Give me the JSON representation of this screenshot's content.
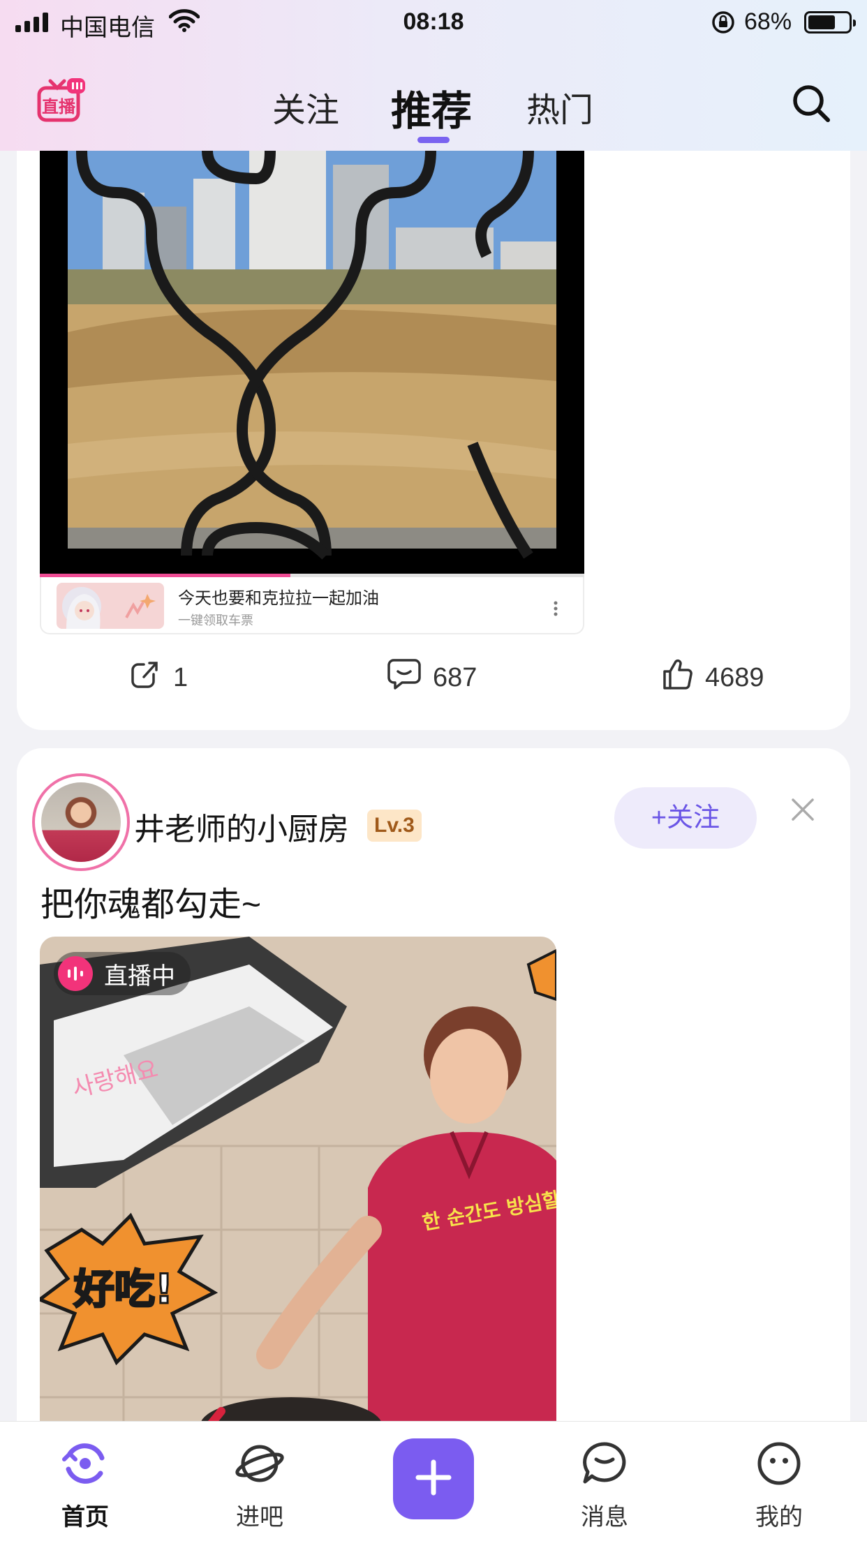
{
  "status_bar": {
    "carrier": "中国电信",
    "time": "08:18",
    "battery": "68%",
    "battery_level": 0.68
  },
  "top_nav": {
    "logo_text": "直播",
    "tabs": [
      {
        "label": "关注",
        "active": false
      },
      {
        "label": "推荐",
        "active": true
      },
      {
        "label": "热门",
        "active": false
      }
    ],
    "search_icon": "search-icon"
  },
  "post1": {
    "video_progress": 0.46,
    "promo": {
      "title": "今天也要和克拉拉一起加油",
      "subtitle": "一键领取车票"
    },
    "actions": {
      "share_count": "1",
      "comment_count": "687",
      "like_count": "4689"
    }
  },
  "post2": {
    "username": "井老师的小厨房",
    "level": "Lv.3",
    "follow_label": "+关注",
    "caption": "把你魂都勾走~",
    "live_badge": "直播中",
    "stickers": {
      "tasty": "好吃!",
      "korean_heart": "사랑해요",
      "korean_caption": "한 순간도 방심할 수 없다 ..."
    }
  },
  "tab_bar": {
    "items": [
      {
        "label": "首页",
        "icon": "home-icon",
        "active": true
      },
      {
        "label": "进吧",
        "icon": "planet-icon",
        "active": false
      },
      {
        "label": "",
        "icon": "plus-icon",
        "active": false
      },
      {
        "label": "消息",
        "icon": "message-icon",
        "active": false
      },
      {
        "label": "我的",
        "icon": "profile-icon",
        "active": false
      }
    ]
  },
  "colors": {
    "accent": "#7b5cf0",
    "live_pink": "#f2337a",
    "level_bg": "#fde6c7"
  }
}
